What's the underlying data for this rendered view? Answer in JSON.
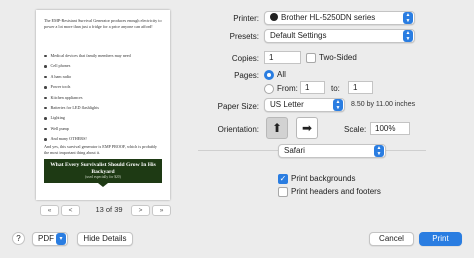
{
  "preview": {
    "para1": "The EMP-Resistant Survival Generator produces enough electricity to power a lot more than just a fridge for a price anyone can afford!",
    "items": [
      "Medical devices that family members may need",
      "Cell phones",
      "A ham radio",
      "Power tools",
      "Kitchen appliances",
      "Batteries for LED flashlights",
      "Lighting",
      "Well pump",
      "And many OTHERS!"
    ],
    "para2": "And yes, this survival generator is EMP PROOF, which is probably the most important thing about it.",
    "banner_title": "What Every Survivalist Should Grow In His Backyard",
    "banner_sub": "(used especially for $20)"
  },
  "nav": {
    "first": "«",
    "prev": "<",
    "page_indicator": "13 of 39",
    "next": ">",
    "last": "»"
  },
  "printer": {
    "label": "Printer:",
    "value": "Brother HL-5250DN series"
  },
  "presets": {
    "label": "Presets:",
    "value": "Default Settings"
  },
  "copies": {
    "label": "Copies:",
    "value": "1",
    "two_sided_label": "Two-Sided"
  },
  "pages": {
    "label": "Pages:",
    "all_label": "All",
    "from_label": "From:",
    "from_value": "1",
    "to_label": "to:",
    "to_value": "1"
  },
  "paper": {
    "label": "Paper Size:",
    "value": "US Letter",
    "dimensions": "8.50 by 11.00 inches"
  },
  "orientation": {
    "label": "Orientation:"
  },
  "scale": {
    "label": "Scale:",
    "value": "100%"
  },
  "app_menu": {
    "value": "Safari"
  },
  "options": {
    "print_backgrounds": "Print backgrounds",
    "print_headers_footers": "Print headers and footers"
  },
  "footer": {
    "help": "?",
    "pdf": "PDF",
    "hide_details": "Hide Details",
    "cancel": "Cancel",
    "print": "Print"
  }
}
